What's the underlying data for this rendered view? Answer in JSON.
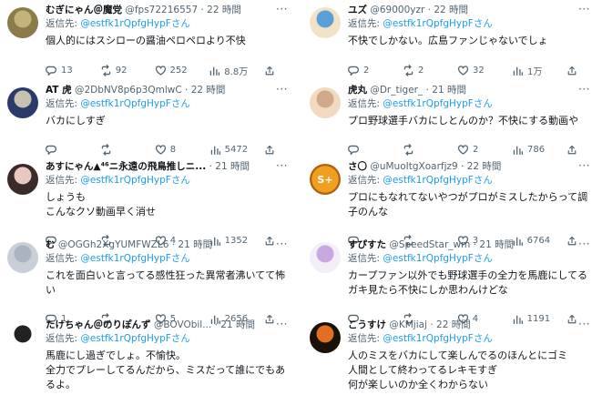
{
  "left": [
    {
      "name": "むぎにゃん＠魔党",
      "handle": "@fps72216557",
      "time": "22 時間",
      "reply_label": "返信先:",
      "reply_mention": "@estfk1rQpfgHypFさん",
      "lines": [
        "個人的にはスシローの醤油ペロペロより不快"
      ],
      "replies": "13",
      "retweets": "92",
      "likes": "252",
      "views": "8.8万",
      "avatar_colors": [
        "#8d7a4a",
        "#c4b37a"
      ]
    },
    {
      "name": "AT 虎",
      "handle": "@2DbNV8p6p3QmlwC",
      "time": "22 時間",
      "reply_label": "返信先:",
      "reply_mention": "@estfk1rQpfgHypFさん",
      "lines": [
        "バカにしすぎ"
      ],
      "replies": "",
      "retweets": "",
      "likes": "8",
      "views": "5472",
      "avatar_colors": [
        "#2a3a6a",
        "#c8c0b0"
      ]
    },
    {
      "name": "あすにゃん▲⁴⁶ニ永遠の飛鳥推しニ...",
      "handle": "",
      "time": "21 時間",
      "reply_label": "返信先:",
      "reply_mention": "@estfk1rQpfgHypFさん",
      "lines": [
        "しょうも",
        "こんなクソ動画早く消せ"
      ],
      "replies": "",
      "retweets": "",
      "likes": "4",
      "views": "1352",
      "avatar_colors": [
        "#3a2a2a",
        "#e8c8c0"
      ]
    },
    {
      "name": "む",
      "handle": "@OGGh2XgYUMFWZL6",
      "time": "21 時間",
      "reply_label": "返信先:",
      "reply_mention": "@estfk1rQpfgHypFさん",
      "lines": [
        "これを面白いと言ってる感性狂った異常者沸いてて怖",
        "い"
      ],
      "replies": "1",
      "retweets": "",
      "likes": "5",
      "views": "2656",
      "avatar_colors": [
        "#c9cfd6",
        "#aab4bf"
      ]
    },
    {
      "name": "たけちゃん＠のりぽんず",
      "handle": "@BOVObil...",
      "time": "21 時間",
      "reply_label": "返信先:",
      "reply_mention": "@estfk1rQpfgHypFさん",
      "lines": [
        "馬鹿にし過ぎでしょ。不愉快。",
        "全力でプレーしてるんだから、ミスだって誰にでもあ",
        "るよ。"
      ],
      "replies": "",
      "retweets": "",
      "likes": "",
      "views": "",
      "avatar_colors": [
        "#ffffff",
        "#222222"
      ]
    }
  ],
  "right": [
    {
      "name": "ユズ",
      "handle": "@69000yzr",
      "time": "22 時間",
      "reply_label": "返信先:",
      "reply_mention": "@estfk1rQpfgHypFさん",
      "lines": [
        "不快でしかない。広島ファンじゃないでしょ"
      ],
      "replies": "2",
      "retweets": "2",
      "likes": "32",
      "views": "1万",
      "avatar_colors": [
        "#f3e3c6",
        "#5aa0d8"
      ]
    },
    {
      "name": "虎丸",
      "handle": "@Dr_tiger_",
      "time": "21 時間",
      "reply_label": "返信先:",
      "reply_mention": "@estfk1rQpfgHypFさん",
      "lines": [
        "プロ野球選手バカにしとんのか？不快にする動画や"
      ],
      "replies": "",
      "retweets": "",
      "likes": "2",
      "views": "786",
      "avatar_colors": [
        "#f2d9c2",
        "#cfa98a"
      ]
    },
    {
      "name": "さ〇",
      "handle": "@uMuoItgXoarfjz9",
      "time": "22 時間",
      "reply_label": "返信先:",
      "reply_mention": "@estfk1rQpfgHypFさん",
      "lines": [
        "プロにもなれてないやつがプロがミスしたからって調",
        "子のんな"
      ],
      "replies": "",
      "retweets": "",
      "likes": "3",
      "views": "6764",
      "avatar_colors": [
        "#f0a020",
        "#b06010"
      ],
      "avatar_text": "S+"
    },
    {
      "name": "すぴすた",
      "handle": "@SpeedStar_wm",
      "time": "21 時間",
      "reply_label": "返信先:",
      "reply_mention": "@estfk1rQpfgHypFさん",
      "lines": [
        "カープファン以外でも野球選手の全力を馬鹿にしてる",
        "ガキ見たら不快にしか思わんけどな"
      ],
      "replies": "",
      "retweets": "",
      "likes": "4",
      "views": "1191",
      "avatar_colors": [
        "#f4eef8",
        "#c8a8e0"
      ]
    },
    {
      "name": "こうすけ",
      "handle": "@KMjiaj",
      "time": "22 時間",
      "reply_label": "返信先:",
      "reply_mention": "@estfk1rQpfgHypFさん",
      "lines": [
        "人のミスをバカにして楽しんでるのほんとにゴミ",
        "人間として終わってるレキモすぎ",
        "何が楽しいのか全くわからない"
      ],
      "replies": "",
      "retweets": "",
      "likes": "",
      "views": "",
      "avatar_colors": [
        "#1a1208",
        "#e07020"
      ]
    }
  ],
  "more_glyph": "···",
  "colors": {
    "accent": "#1d9bf0",
    "muted": "#536471",
    "text": "#0f1419"
  }
}
